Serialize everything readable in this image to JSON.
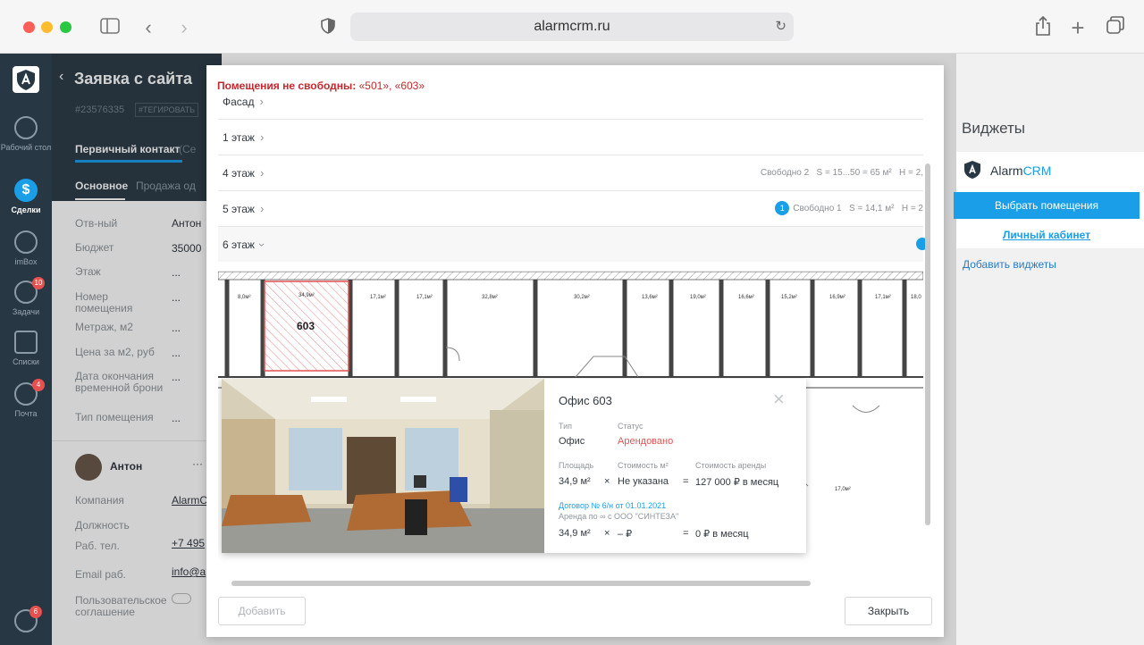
{
  "browser": {
    "url": "alarmcrm.ru"
  },
  "nav": {
    "items": [
      {
        "label": "Рабочий стол"
      },
      {
        "label": "Сделки"
      },
      {
        "label": "imBox"
      },
      {
        "label": "Задачи",
        "badge": "10"
      },
      {
        "label": "Списки"
      },
      {
        "label": "Почта",
        "badge": "4"
      }
    ],
    "bottom_badge": "6"
  },
  "lead": {
    "title": "Заявка с сайта",
    "id": "#23576335",
    "tag_button": "#ТЕГИРОВАТЬ",
    "stage": "Первичный контакт",
    "stage_suffix": "(Се",
    "tabs": [
      "Основное",
      "Продажа од"
    ],
    "fields": [
      {
        "label": "Отв-ный",
        "value": "Антон"
      },
      {
        "label": "Бюджет",
        "value": "35000"
      },
      {
        "label": "Этаж",
        "value": "..."
      },
      {
        "label": "Номер помещения",
        "value": "..."
      },
      {
        "label": "Метраж, м2",
        "value": "..."
      },
      {
        "label": "Цена за м2, руб",
        "value": "..."
      },
      {
        "label": "Дата окончания временной брони",
        "value": "..."
      },
      {
        "label": "Тип помещения",
        "value": "..."
      }
    ],
    "contact": {
      "name": "Антон",
      "more": "···",
      "fields": [
        {
          "label": "Компания",
          "value": "AlarmC"
        },
        {
          "label": "Должность",
          "value": ""
        },
        {
          "label": "Раб. тел.",
          "value": "+7 495"
        },
        {
          "label": "Email раб.",
          "value": "info@a"
        },
        {
          "label": "Пользовательское соглашение",
          "value": ""
        }
      ]
    }
  },
  "modal": {
    "warning_label": "Помещения не свободны:",
    "warning_rooms": "«501», «603»",
    "floors": [
      {
        "name": "Фасад",
        "info": ""
      },
      {
        "name": "1 этаж",
        "info": ""
      },
      {
        "name": "4 этаж",
        "free": "Свободно 2",
        "area": "S = 15...50 = 65 м²",
        "height": "H = 2,"
      },
      {
        "name": "5 этаж",
        "count": "1",
        "free": "Свободно 1",
        "area": "S = 14,1 м²",
        "height": "H = 2"
      },
      {
        "name": "6 этаж",
        "info": ""
      }
    ],
    "plan_rooms": [
      "8,0м²",
      "34,9м²",
      "17,1м²",
      "17,1м²",
      "32,8м²",
      "30,2м²",
      "13,6м²",
      "19,0м²",
      "16,6м²",
      "15,2м²",
      "16,9м²",
      "17,1м²",
      "18,0",
      "17,0м²"
    ],
    "plan_selected": "603",
    "add_button": "Добавить",
    "close_button": "Закрыть"
  },
  "card": {
    "title": "Офис 603",
    "type_label": "Тип",
    "type_value": "Офис",
    "status_label": "Статус",
    "status_value": "Арендовано",
    "area_label": "Площадь",
    "area_value": "34,9 м²",
    "price_label": "Стоимость м²",
    "price_value": "Не указана",
    "rent_label": "Стоимость аренды",
    "rent_value": "127 000 ₽ в месяц",
    "times": "×",
    "equals": "=",
    "contract_link": "Договор № 6/н от 01.01.2021",
    "contract_note": "Аренда по ∞ с ООО \"СИНТЕЗА\"",
    "c_area": "34,9 м²",
    "c_price": "– ₽",
    "c_rent": "0 ₽ в месяц"
  },
  "widgets": {
    "title": "Виджеты",
    "brand_a": "Alarm",
    "brand_b": "CRM",
    "select_button": "Выбрать помещения",
    "cabinet_link": "Личный кабинет",
    "add_link": "Добавить виджеты"
  },
  "colors": {
    "accent": "#1b9ee8",
    "danger": "#c3282d",
    "nav_bg": "#273744",
    "status_red": "#e6514f"
  }
}
